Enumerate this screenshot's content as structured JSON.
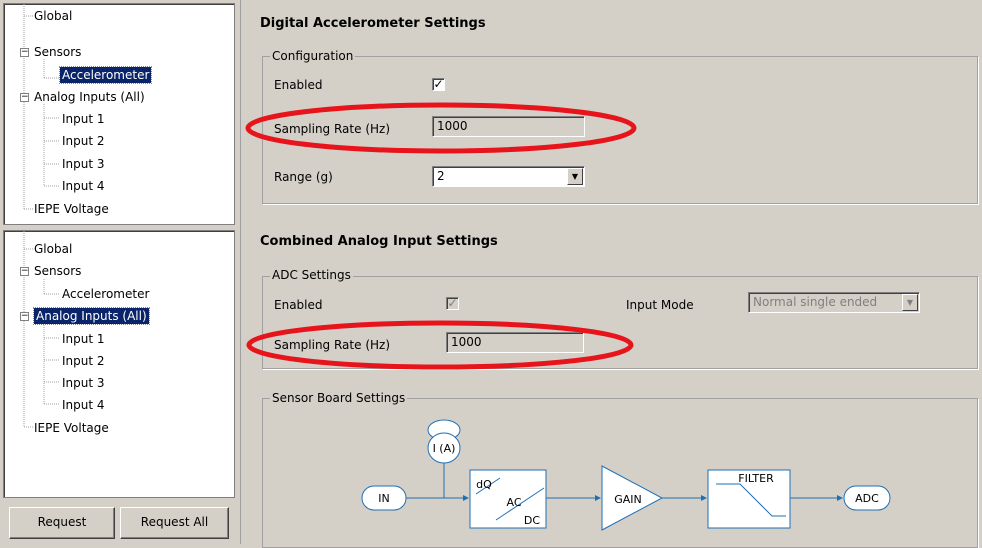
{
  "tree_top": {
    "items": [
      {
        "label": "Global"
      },
      {
        "label": "Sensors"
      },
      {
        "label": "Accelerometer"
      },
      {
        "label": "Analog Inputs (All)"
      },
      {
        "label": "Input 1"
      },
      {
        "label": "Input 2"
      },
      {
        "label": "Input 3"
      },
      {
        "label": "Input 4"
      },
      {
        "label": "IEPE Voltage"
      }
    ],
    "selected": "Accelerometer"
  },
  "tree_bottom": {
    "items": [
      {
        "label": "Global"
      },
      {
        "label": "Sensors"
      },
      {
        "label": "Accelerometer"
      },
      {
        "label": "Analog Inputs (All)"
      },
      {
        "label": "Input 1"
      },
      {
        "label": "Input 2"
      },
      {
        "label": "Input 3"
      },
      {
        "label": "Input 4"
      },
      {
        "label": "IEPE Voltage"
      }
    ],
    "selected": "Analog Inputs (All)"
  },
  "buttons": {
    "request": "Request",
    "request_all": "Request All"
  },
  "accel": {
    "heading": "Digital Accelerometer Settings",
    "group": "Configuration",
    "enabled_label": "Enabled",
    "enabled": true,
    "sampling_label": "Sampling Rate (Hz)",
    "sampling_value": "1000",
    "range_label": "Range (g)",
    "range_value": "2"
  },
  "analog": {
    "heading": "Combined Analog Input Settings",
    "group": "ADC Settings",
    "enabled_label": "Enabled",
    "enabled": true,
    "input_mode_label": "Input Mode",
    "input_mode_value": "Normal single ended",
    "sampling_label": "Sampling Rate (Hz)",
    "sampling_value": "1000"
  },
  "sensor_board": {
    "group": "Sensor Board Settings",
    "diagram": {
      "in": "IN",
      "current": "I (A)",
      "dq": "dQ",
      "ac": "AC",
      "dc": "DC",
      "gain": "GAIN",
      "filter": "FILTER",
      "adc": "ADC"
    }
  },
  "colors": {
    "highlight_ellipse": "#e8141c",
    "selection": "#0a246a"
  }
}
